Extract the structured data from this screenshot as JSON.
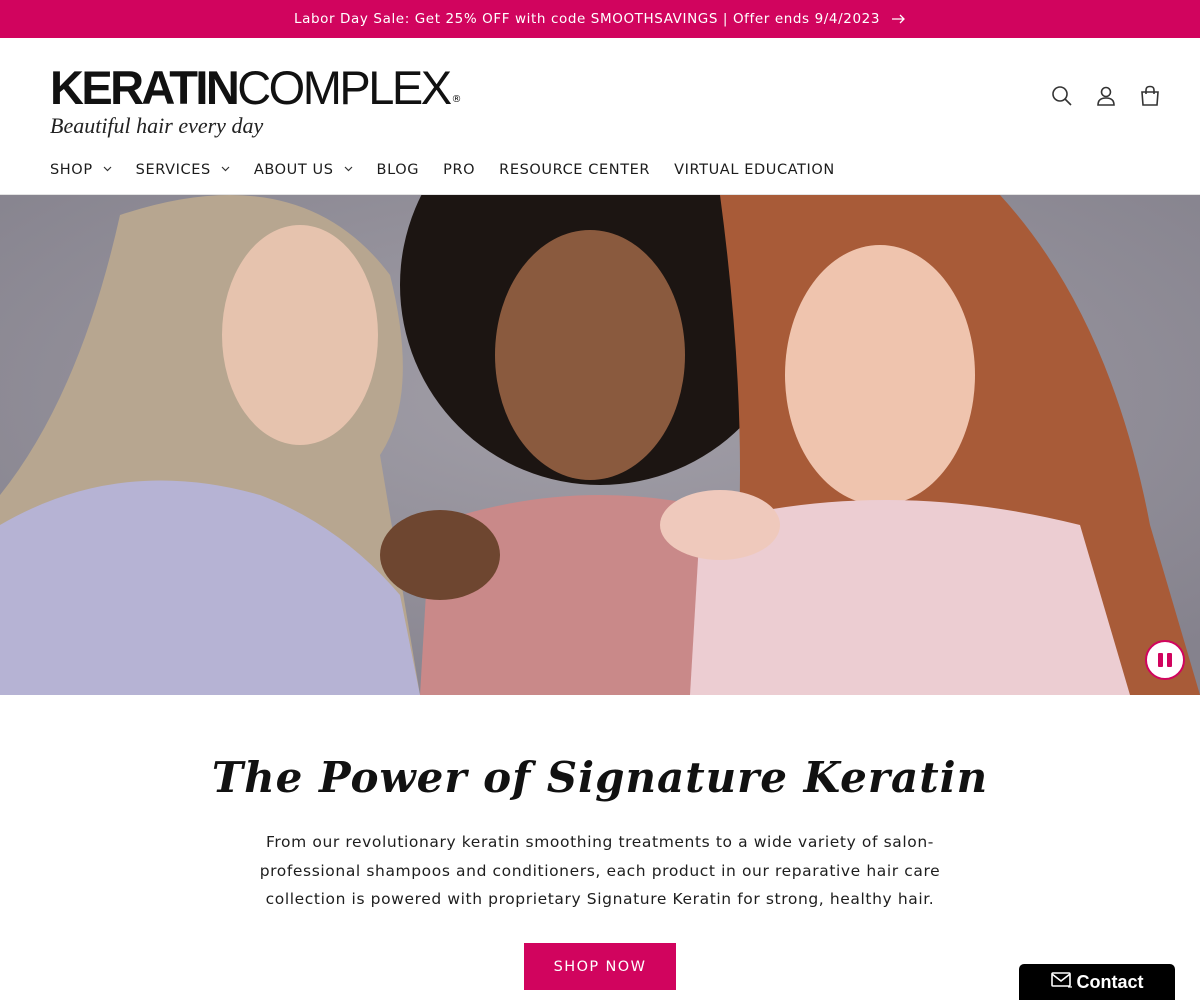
{
  "announcement": {
    "text": "Labor Day Sale: Get 25% OFF with code SMOOTHSAVINGS |  Offer ends 9/4/2023",
    "arrow_icon": "arrow-right-icon"
  },
  "brand": {
    "logo_bold": "KERATIN",
    "logo_light": "COMPLEX",
    "logo_reg": "®",
    "tagline": "Beautiful hair every day",
    "accent_color": "#d1045e"
  },
  "header_icons": [
    "search-icon",
    "account-icon",
    "cart-icon"
  ],
  "nav": {
    "items": [
      {
        "label": "SHOP",
        "has_dropdown": true
      },
      {
        "label": "SERVICES",
        "has_dropdown": true
      },
      {
        "label": "ABOUT US",
        "has_dropdown": true
      },
      {
        "label": "BLOG",
        "has_dropdown": false
      },
      {
        "label": "PRO",
        "has_dropdown": false
      },
      {
        "label": "RESOURCE CENTER",
        "has_dropdown": false
      },
      {
        "label": "VIRTUAL EDUCATION",
        "has_dropdown": false
      }
    ]
  },
  "hero": {
    "pause_icon": "pause-icon"
  },
  "main": {
    "title": "The Power of Signature Keratin",
    "description": "From our revolutionary keratin smoothing treatments to a wide variety of salon-professional shampoos and conditioners, each product in our reparative hair care collection is powered with proprietary Signature Keratin for strong, healthy hair.",
    "cta": "SHOP NOW"
  },
  "contact": {
    "label": "Contact",
    "icon": "mail-icon"
  }
}
